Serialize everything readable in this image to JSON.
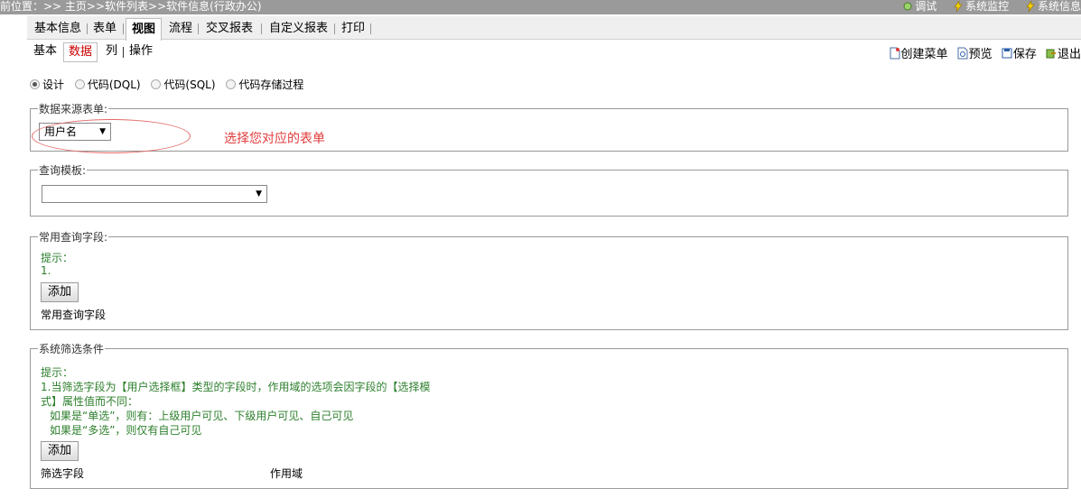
{
  "breadcrumb": "前位置：>> 主页>>软件列表>>软件信息(行政办公)",
  "top_tools": [
    "调试",
    "系统监控",
    "系统信息"
  ],
  "main_tabs": [
    {
      "label": "基本信息",
      "active": false
    },
    {
      "label": "表单",
      "active": false
    },
    {
      "label": "视图",
      "active": true
    },
    {
      "label": "流程",
      "active": false
    },
    {
      "label": "交叉报表",
      "active": false
    },
    {
      "label": "自定义报表",
      "active": false
    },
    {
      "label": "打印",
      "active": false
    }
  ],
  "sub_tabs": [
    {
      "label": "基本",
      "active": false
    },
    {
      "label": "数据",
      "active": true
    },
    {
      "label": "列",
      "active": false
    },
    {
      "label": "操作",
      "active": false
    }
  ],
  "actions": [
    "创建菜单",
    "预览",
    "保存",
    "退出"
  ],
  "mode_radios": [
    {
      "label": "设计",
      "checked": true
    },
    {
      "label": "代码(DQL)",
      "checked": false
    },
    {
      "label": "代码(SQL)",
      "checked": false
    },
    {
      "label": "代码存储过程",
      "checked": false
    }
  ],
  "datasource": {
    "legend": "数据来源表单:",
    "selected": "用户名",
    "annotation": "选择您对应的表单"
  },
  "query_template": {
    "legend": "查询模板:",
    "selected": ""
  },
  "common_query": {
    "legend": "常用查询字段:",
    "hint_title": "提示：",
    "hint_line1": "1.",
    "add_label": "添加",
    "field_label": "常用查询字段"
  },
  "system_filter": {
    "legend": "系统筛选条件",
    "hint_title": "提示：",
    "hint_line1": "1.当筛选字段为【用户选择框】类型的字段时，作用域的选项会因字段的【选择模",
    "hint_line2": "式】属性值而不同：",
    "hint_line3": "如果是“单选”，则有：上级用户可见、下级用户可见、自己可见",
    "hint_line4": "如果是“多选”，则仅有自己可见",
    "add_label": "添加",
    "col_field": "筛选字段",
    "col_scope": "作用域"
  },
  "colors": {
    "topbar": "#9a9a9a",
    "hint_green": "#2c7f2c",
    "annotation_red": "#e23c3c",
    "active_subtab": "#cc0000"
  }
}
